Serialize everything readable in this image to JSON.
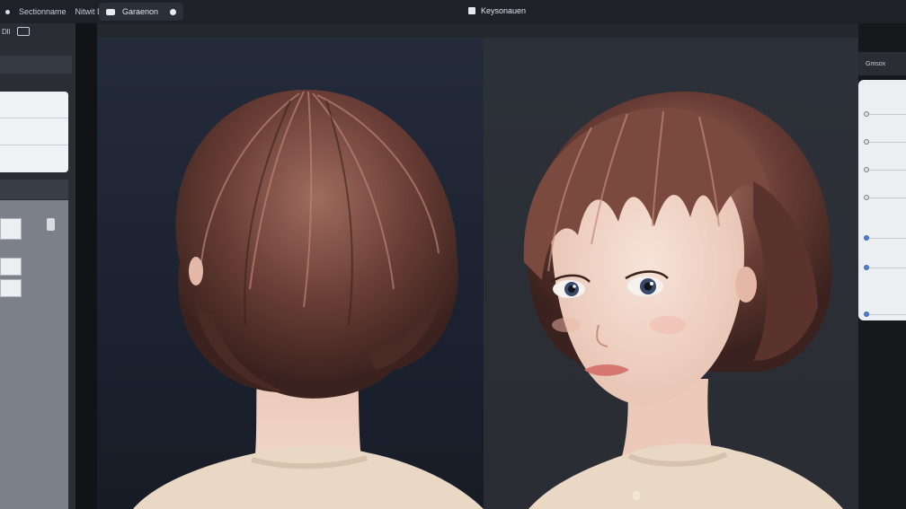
{
  "topbar": {
    "left_items": [
      "Sectionname",
      "Nitwit Dotte"
    ],
    "tab_label": "Garaenon",
    "window_title": "Keysonauen"
  },
  "left_panel": {
    "top_row": [
      "Dll"
    ],
    "header1": "",
    "card_rows": [
      "",
      "",
      ""
    ],
    "header2": "",
    "lower_label": ""
  },
  "right_panel": {
    "header": "Gmsox",
    "sliders": [
      {
        "active": false
      },
      {
        "active": false
      },
      {
        "active": false
      },
      {
        "active": false
      },
      {
        "active": true
      },
      {
        "active": true
      },
      {
        "active": true
      }
    ]
  },
  "viewports": {
    "left": {
      "subject": "back-of-head-updo"
    },
    "right": {
      "subject": "front-portrait-bob"
    }
  },
  "colors": {
    "hair": "#6a3e36",
    "skin": "#f3d9cc",
    "sweater": "#e9d8c4",
    "accent": "#4a7fd4"
  }
}
